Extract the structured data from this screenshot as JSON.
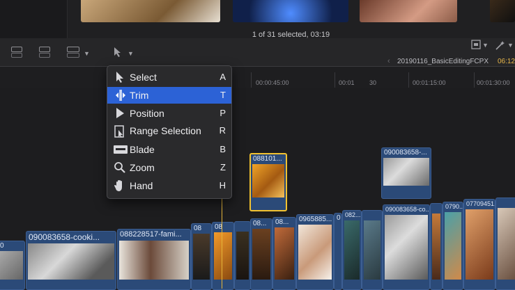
{
  "browser": {
    "status": "1 of 31 selected, 03:19"
  },
  "toolbar": {
    "project_name": "20190116_BasicEditingFCPX",
    "timecode": "06:12"
  },
  "ruler": {
    "ticks": [
      "00:00:45:00",
      "00:01",
      "30",
      "00:01:15:00",
      "00:01:30:00"
    ]
  },
  "tool_menu": {
    "items": [
      {
        "label": "Select",
        "shortcut": "A",
        "icon": "arrow-pointer-icon"
      },
      {
        "label": "Trim",
        "shortcut": "T",
        "icon": "trim-icon"
      },
      {
        "label": "Position",
        "shortcut": "P",
        "icon": "position-arrow-icon"
      },
      {
        "label": "Range Selection",
        "shortcut": "R",
        "icon": "range-selection-icon"
      },
      {
        "label": "Blade",
        "shortcut": "B",
        "icon": "blade-icon"
      },
      {
        "label": "Zoom",
        "shortcut": "Z",
        "icon": "magnifier-icon"
      },
      {
        "label": "Hand",
        "shortcut": "H",
        "icon": "hand-icon"
      }
    ],
    "selected": "Trim"
  },
  "clips": {
    "connected_selected": "088101...",
    "connected_right": "090083658-...",
    "primary": [
      "090083658-cooki...",
      "088228517-fami...",
      "08",
      "08",
      "08...",
      "08...",
      "0965885...",
      "0",
      "082...",
      "090083658-co...",
      "0790...",
      "07709451...",
      "0"
    ]
  },
  "colors": {
    "accent": "#2c62d6",
    "clip_blue": "#2b4a78",
    "selection_yellow": "#f2c230"
  }
}
